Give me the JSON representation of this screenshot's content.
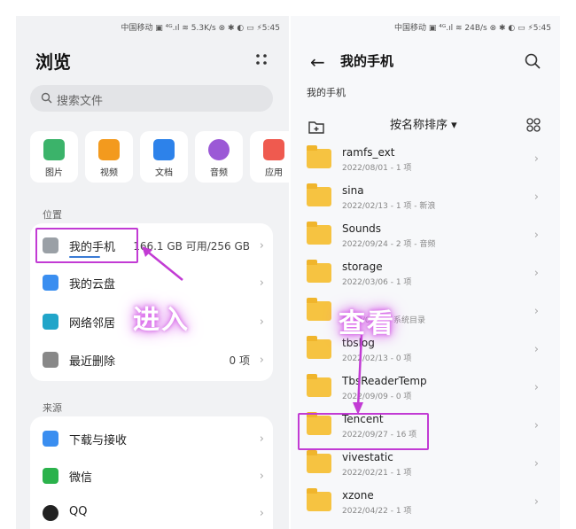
{
  "left": {
    "status": "中国移动 ▣ ⁴ᴳ.ıl ≋ 5.3K/s   ⊗ ✱ ◐ ▭ ⚡5:45",
    "title": "浏览",
    "search_placeholder": "搜索文件",
    "categories": [
      {
        "label": "图片",
        "icon": "image-icon",
        "color": "#3bb36a"
      },
      {
        "label": "视频",
        "icon": "video-icon",
        "color": "#f39a1e"
      },
      {
        "label": "文档",
        "icon": "document-icon",
        "color": "#2d82ea"
      },
      {
        "label": "音频",
        "icon": "audio-icon",
        "color": "#9b59d6"
      },
      {
        "label": "应用",
        "icon": "app-icon",
        "color": "#ef5a4f"
      }
    ],
    "location_label": "位置",
    "locations": [
      {
        "label": "我的手机",
        "value": "166.1 GB 可用/256 GB",
        "icon": "phone-icon",
        "color": "#9aa0a6"
      },
      {
        "label": "我的云盘",
        "value": "",
        "icon": "cloud-icon",
        "color": "#3a8ef0"
      },
      {
        "label": "网络邻居",
        "value": "",
        "icon": "network-icon",
        "color": "#21a5c9"
      },
      {
        "label": "最近删除",
        "value": "0 项",
        "icon": "trash-icon",
        "color": "#888888"
      }
    ],
    "source_label": "来源",
    "sources": [
      {
        "label": "下载与接收",
        "icon": "download-icon",
        "color": "#3a8ef0"
      },
      {
        "label": "微信",
        "icon": "wechat-icon",
        "color": "#2bb24c"
      },
      {
        "label": "QQ",
        "icon": "qq-icon",
        "color": "#222222"
      }
    ],
    "overlay": "进入",
    "storage_used_fraction": 0.35
  },
  "right": {
    "status": "中国移动 ▣ ⁴ᴳ.ıl ≋ 24B/s   ⊗ ✱ ◐ ▭ ⚡5:45",
    "title": "我的手机",
    "breadcrumb": "我的手机",
    "sort_label": "按名称排序 ▾",
    "overlay": "查看",
    "files": [
      {
        "name": "ramfs_ext",
        "meta": "2022/08/01 - 1 项"
      },
      {
        "name": "sina",
        "meta": "2022/02/13 - 1 项 - 新浪"
      },
      {
        "name": "Sounds",
        "meta": "2022/09/24 - 2 项 - 音频"
      },
      {
        "name": "storage",
        "meta": "2022/03/06 - 1 项"
      },
      {
        "name": "",
        "meta": "2022/09/... - 系统目录"
      },
      {
        "name": "tbslog",
        "meta": "2022/02/13 - 0 项"
      },
      {
        "name": "TbsReaderTemp",
        "meta": "2022/09/09 - 0 项"
      },
      {
        "name": "Tencent",
        "meta": "2022/09/27 - 16 项"
      },
      {
        "name": "vivestatic",
        "meta": "2022/02/21 - 1 项"
      },
      {
        "name": "xzone",
        "meta": "2022/04/22 - 1 项"
      }
    ]
  },
  "colors": {
    "highlight": "#c23bd4",
    "folder": "#f6c341",
    "accent": "#3a7bd5"
  }
}
